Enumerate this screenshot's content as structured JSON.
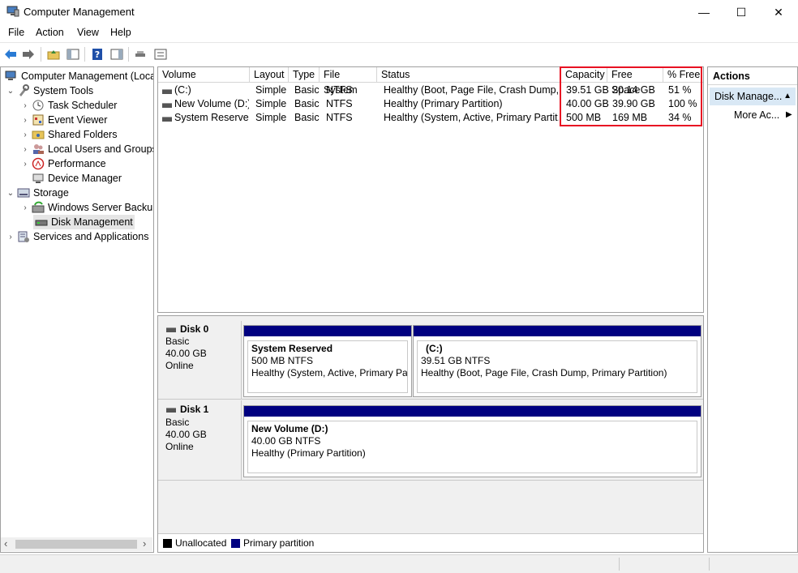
{
  "window": {
    "title": "Computer Management",
    "controls": {
      "minimize": "—",
      "maximize": "☐",
      "close": "✕"
    }
  },
  "menu": [
    "File",
    "Action",
    "View",
    "Help"
  ],
  "toolbar": {
    "icons": [
      "back-arrow-icon",
      "forward-arrow-icon",
      "up-folder-icon",
      "show-hide-tree-icon",
      "help-icon",
      "show-hide-action-pane-icon",
      "connect-icon",
      "properties-icon"
    ]
  },
  "tree": {
    "root": "Computer Management (Local",
    "system_tools": "System Tools",
    "task_scheduler": "Task Scheduler",
    "event_viewer": "Event Viewer",
    "shared_folders": "Shared Folders",
    "local_users": "Local Users and Groups",
    "performance": "Performance",
    "device_manager": "Device Manager",
    "storage": "Storage",
    "wsb": "Windows Server Backup",
    "disk_mgmt": "Disk Management",
    "services": "Services and Applications"
  },
  "volume_table": {
    "headers": [
      "Volume",
      "Layout",
      "Type",
      "File System",
      "Status",
      "Capacity",
      "Free Space",
      "% Free"
    ],
    "rows": [
      [
        "(C:)",
        "Simple",
        "Basic",
        "NTFS",
        "Healthy (Boot, Page File, Crash Dump,...",
        "39.51 GB",
        "20.14 GB",
        "51 %"
      ],
      [
        "New Volume (D:)",
        "Simple",
        "Basic",
        "NTFS",
        "Healthy (Primary Partition)",
        "40.00 GB",
        "39.90 GB",
        "100 %"
      ],
      [
        "System Reserved",
        "Simple",
        "Basic",
        "NTFS",
        "Healthy (System, Active, Primary Partit...",
        "500 MB",
        "169 MB",
        "34 %"
      ]
    ]
  },
  "disks": [
    {
      "name": "Disk 0",
      "type": "Basic",
      "size": "40.00 GB",
      "state": "Online",
      "partitions": [
        {
          "title": "System Reserved",
          "size": "500 MB NTFS",
          "status": "Healthy (System, Active, Primary Par"
        },
        {
          "title": "(C:)",
          "size": "39.51 GB NTFS",
          "status": "Healthy (Boot, Page File, Crash Dump, Primary Partition)"
        }
      ]
    },
    {
      "name": "Disk 1",
      "type": "Basic",
      "size": "40.00 GB",
      "state": "Online",
      "partitions": [
        {
          "title": "New Volume  (D:)",
          "size": "40.00 GB NTFS",
          "status": "Healthy (Primary Partition)"
        }
      ]
    }
  ],
  "legend": {
    "unallocated": "Unallocated",
    "primary": "Primary partition",
    "colors": {
      "unallocated": "#000000",
      "primary": "#000080"
    }
  },
  "actions": {
    "header": "Actions",
    "selected": "Disk Manage...",
    "more": "More Ac..."
  },
  "colors": {
    "highlight_box": "#e81123",
    "partition_bar": "#000080",
    "selection": "#d9e8f5"
  }
}
